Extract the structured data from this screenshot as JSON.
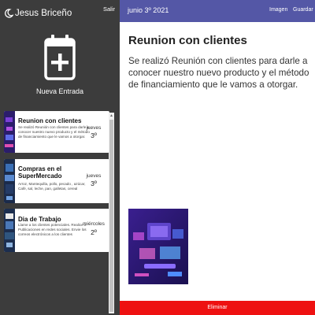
{
  "user": {
    "name": "Jesus Briceño",
    "logout_label": "Salir"
  },
  "new_entry": {
    "label": "Nueva Entrada"
  },
  "entries": [
    {
      "title": "Reunion con clientes",
      "body": "Se realizó Reunión con clientes para darle a conocer nuestro nuevo producto y el método de financiamiento que le vamos a otorgar.",
      "day": "jueves",
      "num": "3º"
    },
    {
      "title": "Compras en el SuperMercado",
      "body": "Arroz, Mantequilla, pollo, pecado , azúcar, Café, sal, leche, pan, galletas, cereal",
      "day": "jueves",
      "num": "3º"
    },
    {
      "title": "Dia de Trabajo",
      "body": "Llame a los clientes potenciales. Realice 2 Publicaciones en redes sociales. Envie los correos electrónicos a los clientes",
      "day": "miércoles",
      "num": "2º"
    }
  ],
  "topbar": {
    "date": "junio 3º 2021",
    "image_label": "Imagen",
    "save_label": "Guardar"
  },
  "main": {
    "title": "Reunion con clientes",
    "text": "Se realizó Reunión con clientes para darle a conocer nuestro nuevo producto y el método de financiamiento que le vamos a otorgar."
  },
  "delete_label": "Eliminar",
  "colors": {
    "sidebar": "#3c3c3c",
    "topbar": "#5457a6",
    "delete": "#ee1111"
  }
}
